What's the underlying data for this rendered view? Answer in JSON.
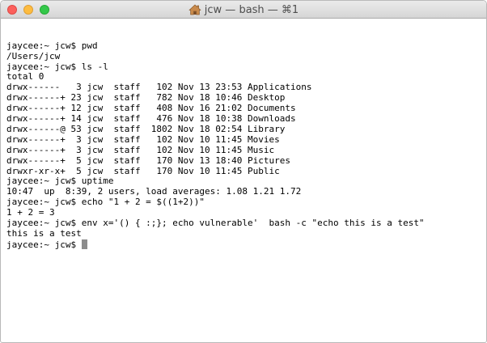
{
  "window": {
    "title": "jcw — bash — ⌘1",
    "title_icon": "home-icon"
  },
  "terminal": {
    "lines": [
      "jaycee:~ jcw$ pwd",
      "/Users/jcw",
      "jaycee:~ jcw$ ls -l",
      "total 0",
      "drwx------   3 jcw  staff   102 Nov 13 23:53 Applications",
      "drwx------+ 23 jcw  staff   782 Nov 18 10:46 Desktop",
      "drwx------+ 12 jcw  staff   408 Nov 16 21:02 Documents",
      "drwx------+ 14 jcw  staff   476 Nov 18 10:38 Downloads",
      "drwx------@ 53 jcw  staff  1802 Nov 18 02:54 Library",
      "drwx------+  3 jcw  staff   102 Nov 10 11:45 Movies",
      "drwx------+  3 jcw  staff   102 Nov 10 11:45 Music",
      "drwx------+  5 jcw  staff   170 Nov 13 18:40 Pictures",
      "drwxr-xr-x+  5 jcw  staff   170 Nov 10 11:45 Public",
      "jaycee:~ jcw$ uptime",
      "10:47  up  8:39, 2 users, load averages: 1.08 1.21 1.72",
      "jaycee:~ jcw$ echo \"1 + 2 = $((1+2))\"",
      "1 + 2 = 3",
      "jaycee:~ jcw$ env x='() { :;}; echo vulnerable'  bash -c \"echo this is a test\"",
      "this is a test"
    ],
    "prompt": "jaycee:~ jcw$ "
  },
  "colors": {
    "close": "#fc605c",
    "minimize": "#fdbc40",
    "zoom": "#34c84a",
    "cursor": "#8c8c8c"
  }
}
